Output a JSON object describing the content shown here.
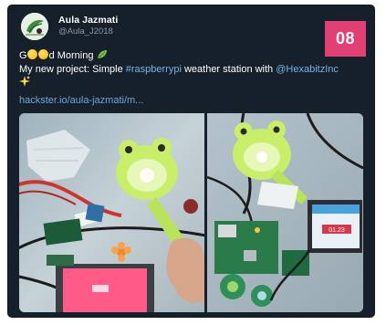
{
  "tweet": {
    "display_name": "Aula Jazmati",
    "handle": "@Aula_J2018",
    "text_line1_a": "G",
    "text_line1_b": "d Morning",
    "text_line2_prefix": "My new project: Simple ",
    "hashtag": "#raspberrypi",
    "text_line2_middle": " weather station with ",
    "mention": "@HexabitzInc",
    "link": "hackster.io/aula-jazmati/m..."
  },
  "badge": {
    "number": "08",
    "color": "#e23f74"
  },
  "photos": {
    "right_screen_value": "01.23"
  },
  "icons": [
    "avatar",
    "smiley-emoji",
    "leaf-emoji",
    "sparkles-emoji"
  ],
  "colors": {
    "card_bg": "#15202b",
    "link": "#6fa7dc",
    "handle": "#8b98a5"
  }
}
